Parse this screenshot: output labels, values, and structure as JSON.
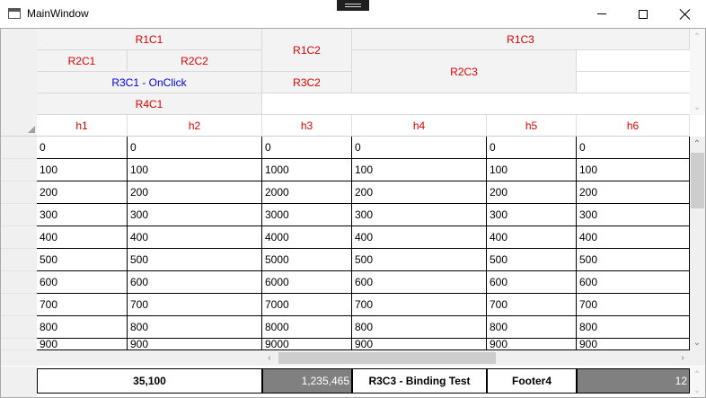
{
  "window": {
    "title": "MainWindow"
  },
  "header": {
    "r1c1": "R1C1",
    "r1c2": "R1C2",
    "r1c3": "R1C3",
    "r2c1": "R2C1",
    "r2c2": "R2C2",
    "r2c3": "R2C3",
    "r3c1": "R3C1 - OnClick",
    "r3c2": "R3C2",
    "r4c1": "R4C1"
  },
  "grid": {
    "columns": [
      "h1",
      "h2",
      "h3",
      "h4",
      "h5",
      "h6"
    ],
    "rows": [
      [
        "0",
        "0",
        "0",
        "0",
        "0",
        "0"
      ],
      [
        "100",
        "100",
        "1000",
        "100",
        "100",
        "100"
      ],
      [
        "200",
        "200",
        "2000",
        "200",
        "200",
        "200"
      ],
      [
        "300",
        "300",
        "3000",
        "300",
        "300",
        "300"
      ],
      [
        "400",
        "400",
        "4000",
        "400",
        "400",
        "400"
      ],
      [
        "500",
        "500",
        "5000",
        "500",
        "500",
        "500"
      ],
      [
        "600",
        "600",
        "6000",
        "600",
        "600",
        "600"
      ],
      [
        "700",
        "700",
        "7000",
        "700",
        "700",
        "700"
      ],
      [
        "800",
        "800",
        "8000",
        "800",
        "800",
        "800"
      ],
      [
        "900",
        "900",
        "9000",
        "900",
        "900",
        "900"
      ]
    ]
  },
  "footer": {
    "f1": "35,100",
    "f2": "1,235,465",
    "f3": "R3C3 - Binding Test",
    "f4": "Footer4",
    "f6": "12"
  },
  "colors": {
    "accent_text": "#e00000",
    "link_text": "#0000ee",
    "footer_gray": "#808080"
  }
}
